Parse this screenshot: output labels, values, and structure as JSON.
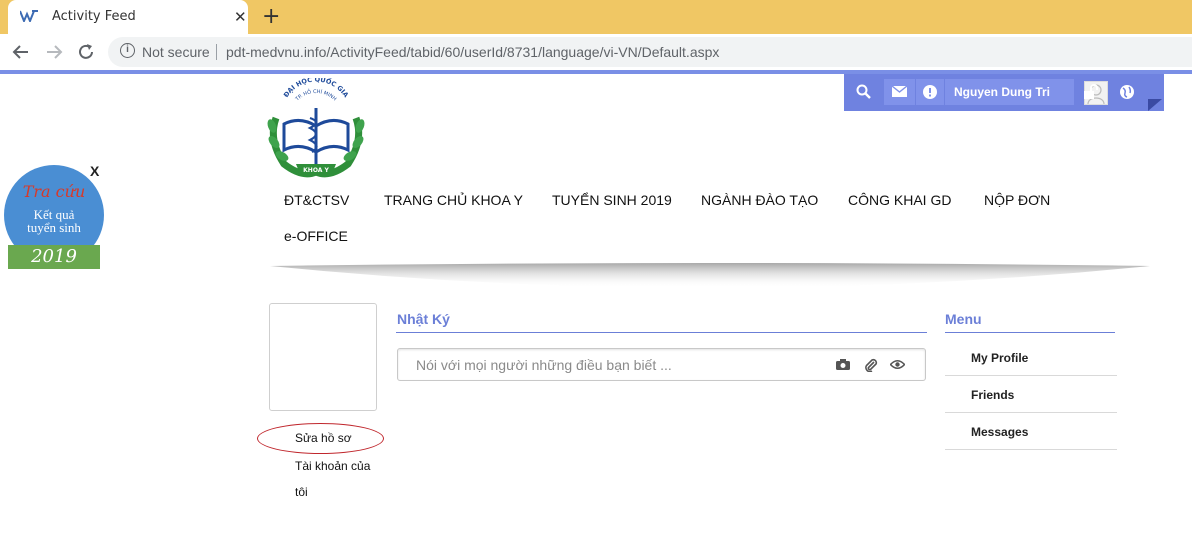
{
  "browser": {
    "tab_title": "Activity Feed",
    "tab_close": "✕",
    "new_tab": "+",
    "security_label": "Not secure",
    "url": "pdt-medvnu.info/ActivityFeed/tabid/60/userId/8731/language/vi-VN/Default.aspx"
  },
  "userbar": {
    "user_name": "Nguyen Dung Tri",
    "icons": [
      "search-icon",
      "mail-icon",
      "alert-icon",
      "avatar",
      "lock-icon",
      "globe-icon"
    ],
    "color": "#6f82e0"
  },
  "logo": {
    "arc_text": "ĐẠI HỌC QUỐC GIA",
    "arc_text2": "TP. HỒ CHÍ MINH",
    "ribbon_text": "KHOA Y"
  },
  "nav": {
    "items": [
      "ĐT&CTSV",
      "TRANG CHỦ KHOA Y",
      "TUYỂN SINH 2019",
      "NGÀNH ĐÀO TẠO",
      "CÔNG KHAI GD",
      "NỘP ĐƠN",
      "e-OFFICE"
    ]
  },
  "float_badge": {
    "close": "X",
    "line1": "Tra cứu",
    "line2": "Kết quả",
    "line3": "tuyển sinh",
    "year": "2019"
  },
  "profile": {
    "edit_profile": "Sửa hồ sơ",
    "my_account_1": "Tài khoản của",
    "my_account_2": "tôi"
  },
  "feed": {
    "title": "Nhật Ký",
    "placeholder": "Nói với mọi người những điều bạn biết ...",
    "icons": [
      "camera-icon",
      "attachment-icon",
      "visibility-icon"
    ]
  },
  "menu": {
    "title": "Menu",
    "items": [
      "My Profile",
      "Friends",
      "Messages"
    ]
  },
  "colors": {
    "accent": "#6b7fd7",
    "tabbar": "#f0c764",
    "highlight_oval": "#c0272d"
  }
}
